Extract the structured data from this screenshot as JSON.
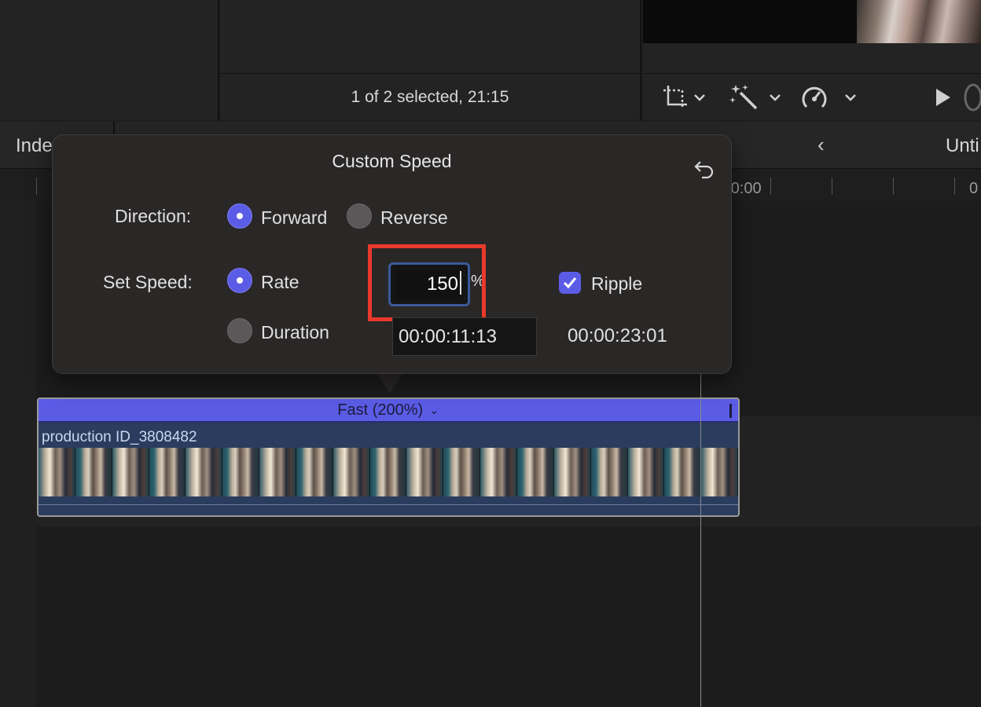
{
  "browser": {
    "selection_status": "1 of 2 selected, 21:15"
  },
  "timeline_header": {
    "index_label": "Inde",
    "project_name": "Unti",
    "ruler_labels": [
      ":00:00",
      "0"
    ]
  },
  "popover": {
    "title": "Custom Speed",
    "direction_label": "Direction:",
    "forward_label": "Forward",
    "reverse_label": "Reverse",
    "direction_selected": "Forward",
    "set_speed_label": "Set Speed:",
    "rate_label": "Rate",
    "duration_label": "Duration",
    "speed_mode_selected": "Rate",
    "rate_value": "150",
    "percent_sign": "%",
    "ripple_label": "Ripple",
    "ripple_checked": true,
    "duration_value": "00:00:11:13",
    "total_duration": "00:00:23:01"
  },
  "clip": {
    "speed_label": "Fast (200%)",
    "name": "production ID_3808482"
  },
  "icons": {
    "transform": "crop-transform-icon",
    "enhance": "magic-wand-icon",
    "retime": "speedometer-icon",
    "play": "play-icon",
    "reset": "undo-arrow-icon"
  },
  "colors": {
    "accent": "#5b5ce6",
    "highlight": "#e8392a",
    "clip": "#2b3d5e"
  }
}
